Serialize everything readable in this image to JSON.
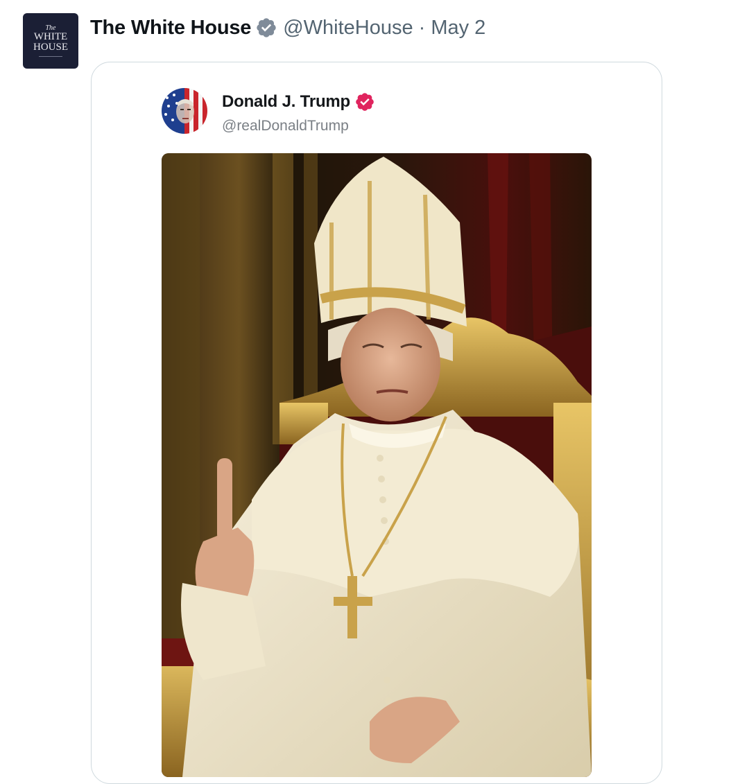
{
  "tweet": {
    "author": {
      "display_name": "The White House",
      "handle": "@WhiteHouse",
      "separator": "·",
      "date": "May 2",
      "avatar": {
        "line1": "The",
        "line2": "WHITE",
        "line3": "HOUSE",
        "bg_color": "#1b1f35"
      },
      "verified_icon": "verified-badge-gray"
    },
    "embedded_post": {
      "display_name": "Donald J. Trump",
      "handle": "@realDonaldTrump",
      "verified_icon": "verified-badge-red",
      "avatar_icon": "flag-portrait-avatar",
      "image": {
        "subject": "pope-portrait-image",
        "palette": [
          "#2a1a0e",
          "#c9a24a",
          "#f2ead3",
          "#7a1212"
        ]
      }
    }
  },
  "colors": {
    "text_primary": "#0f1419",
    "text_secondary": "#536471",
    "border": "#cfd9de",
    "badge_gray": "#7f8b99",
    "badge_red": "#e0245e"
  }
}
